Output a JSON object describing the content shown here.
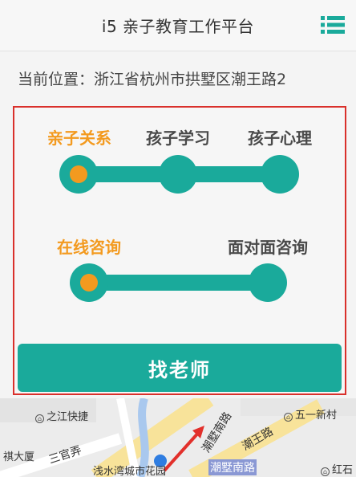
{
  "header": {
    "title": "i5 亲子教育工作平台",
    "menu_icon": "list-menu-icon"
  },
  "location": {
    "label": "当前位置：浙江省杭州市拱墅区潮王路2"
  },
  "colors": {
    "accent": "#1aaa9b",
    "active": "#f39a1f",
    "highlight_border": "#d9302b"
  },
  "steps_row1": {
    "items": [
      "亲子关系",
      "孩子学习",
      "孩子心理"
    ],
    "selected": "亲子关系"
  },
  "steps_row2": {
    "items": [
      "在线咨询",
      "面对面咨询"
    ],
    "selected": "在线咨询"
  },
  "cta": {
    "label": "找老师"
  },
  "map": {
    "labels": [
      "之江快捷",
      "五一新村",
      "祺大厦",
      "三官弄",
      "浅水湾城市花园",
      "潮墅南路",
      "潮王路",
      "红石"
    ],
    "highlighted_road": "潮墅南路"
  }
}
